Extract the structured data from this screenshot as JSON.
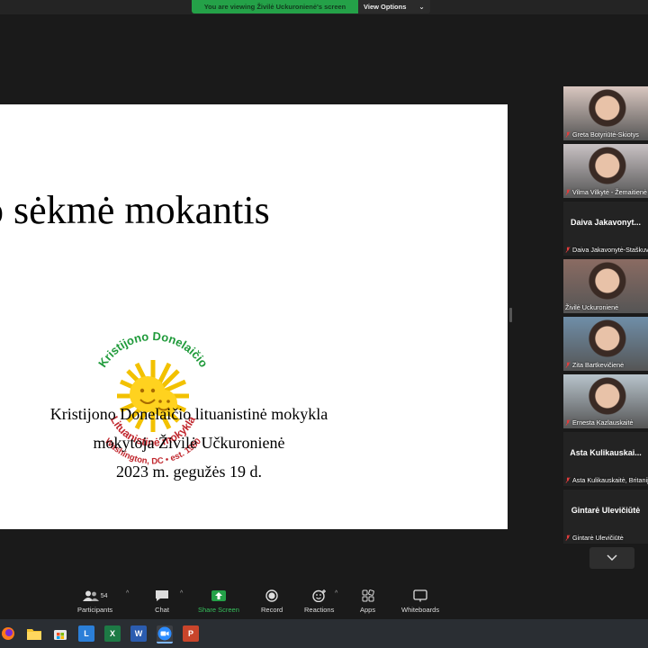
{
  "banner": {
    "message": "You are viewing Živilė Uckuronienė's screen",
    "options_label": "View Options"
  },
  "slide": {
    "title": "ko sėkmė mokantis",
    "logo": {
      "arc_top": "Kristijono Donelaičio",
      "arc_mid": "Lituanistinė mokykla",
      "arc_bottom": "Washington, DC • est. 1960"
    },
    "lines": [
      "Kristijono Donelaičio lituanistinė mokykla",
      "mokytoja Živilė Učkuronienė",
      "2023 m. gegužės 19 d."
    ]
  },
  "participants": [
    {
      "name": "Greta Botyriūtė-Skiotys",
      "big": "",
      "video": true,
      "bg": "#d9c7c0"
    },
    {
      "name": "Vilma Vilkytė - Žemaitienė",
      "big": "",
      "video": true,
      "bg": "#c9c2c4"
    },
    {
      "name": "Daiva Jakavonytė-Staškuvienė",
      "big": "Daiva Jakavonyt...",
      "video": false,
      "bg": "#232323"
    },
    {
      "name": "Živilė Uckuronienė",
      "big": "",
      "video": true,
      "bg": "#8a6b62",
      "active": true
    },
    {
      "name": "Zita Bartkevičienė",
      "big": "",
      "video": true,
      "bg": "#6f8ea8"
    },
    {
      "name": "Ernesta Kazlauskaitė",
      "big": "",
      "video": true,
      "bg": "#b8c4cc"
    },
    {
      "name": "Asta Kulikauskaitė, Britanija",
      "big": "Asta Kulikauskai...",
      "video": false,
      "bg": "#232323"
    },
    {
      "name": "Gintarė Ulevičiūtė",
      "big": "Gintarė Ulevičiūtė",
      "video": false,
      "bg": "#232323"
    }
  ],
  "controls": {
    "participants_label": "Participants",
    "participants_count": "54",
    "chat_label": "Chat",
    "share_label": "Share Screen",
    "record_label": "Record",
    "reactions_label": "Reactions",
    "apps_label": "Apps",
    "whiteboards_label": "Whiteboards",
    "share_color": "#24a148"
  },
  "taskbar": {
    "icons": [
      "firefox-icon",
      "file-explorer-icon",
      "store-icon",
      "l-app-icon",
      "excel-icon",
      "word-icon",
      "zoom-icon",
      "powerpoint-icon"
    ]
  }
}
